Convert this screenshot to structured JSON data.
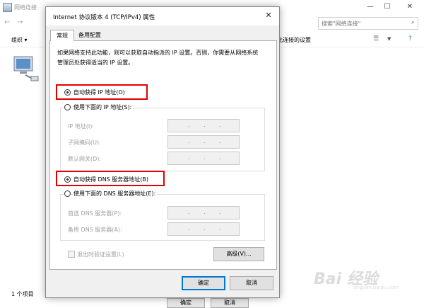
{
  "background_window": {
    "title": "网络连接",
    "search_placeholder": "搜索\"网络连接\"",
    "organize_label": "组织 ▾",
    "command_text": "此连接的设置",
    "status_count": "1 个项目",
    "bottom_buttons": [
      "确定",
      "取消"
    ]
  },
  "dialog": {
    "title": "Internet 协议版本 4 (TCP/IPv4) 属性",
    "tabs": [
      "常规",
      "备用配置"
    ],
    "description": "如果网络支持此功能，则可以获取自动指派的 IP 设置。否则，你需要从网络系统管理员处获得适当的 IP 设置。",
    "ip_auto_label": "自动获得 IP 地址(O)",
    "ip_manual_label": "使用下面的 IP 地址(S):",
    "ip_fields": [
      {
        "label": "IP 地址(I):",
        "value": ".   .   ."
      },
      {
        "label": "子网掩码(U):",
        "value": ".   .   ."
      },
      {
        "label": "默认网关(D):",
        "value": ".   .   ."
      }
    ],
    "dns_auto_label": "自动获得 DNS 服务器地址(B)",
    "dns_manual_label": "使用下面的 DNS 服务器地址(E):",
    "dns_fields": [
      {
        "label": "首选 DNS 服务器(P):",
        "value": ".   .   ."
      },
      {
        "label": "备用 DNS 服务器(A):",
        "value": ".   .   ."
      }
    ],
    "validate_label": "退出时验证设置(L)",
    "advanced_label": "高级(V)...",
    "ok_label": "确定",
    "cancel_label": "取消",
    "selected": {
      "ip": "auto",
      "dns": "auto"
    },
    "highlight_color": "#e00000"
  },
  "watermark": {
    "logo": "Bai 经验",
    "url": "jingyan.baidu.com"
  }
}
